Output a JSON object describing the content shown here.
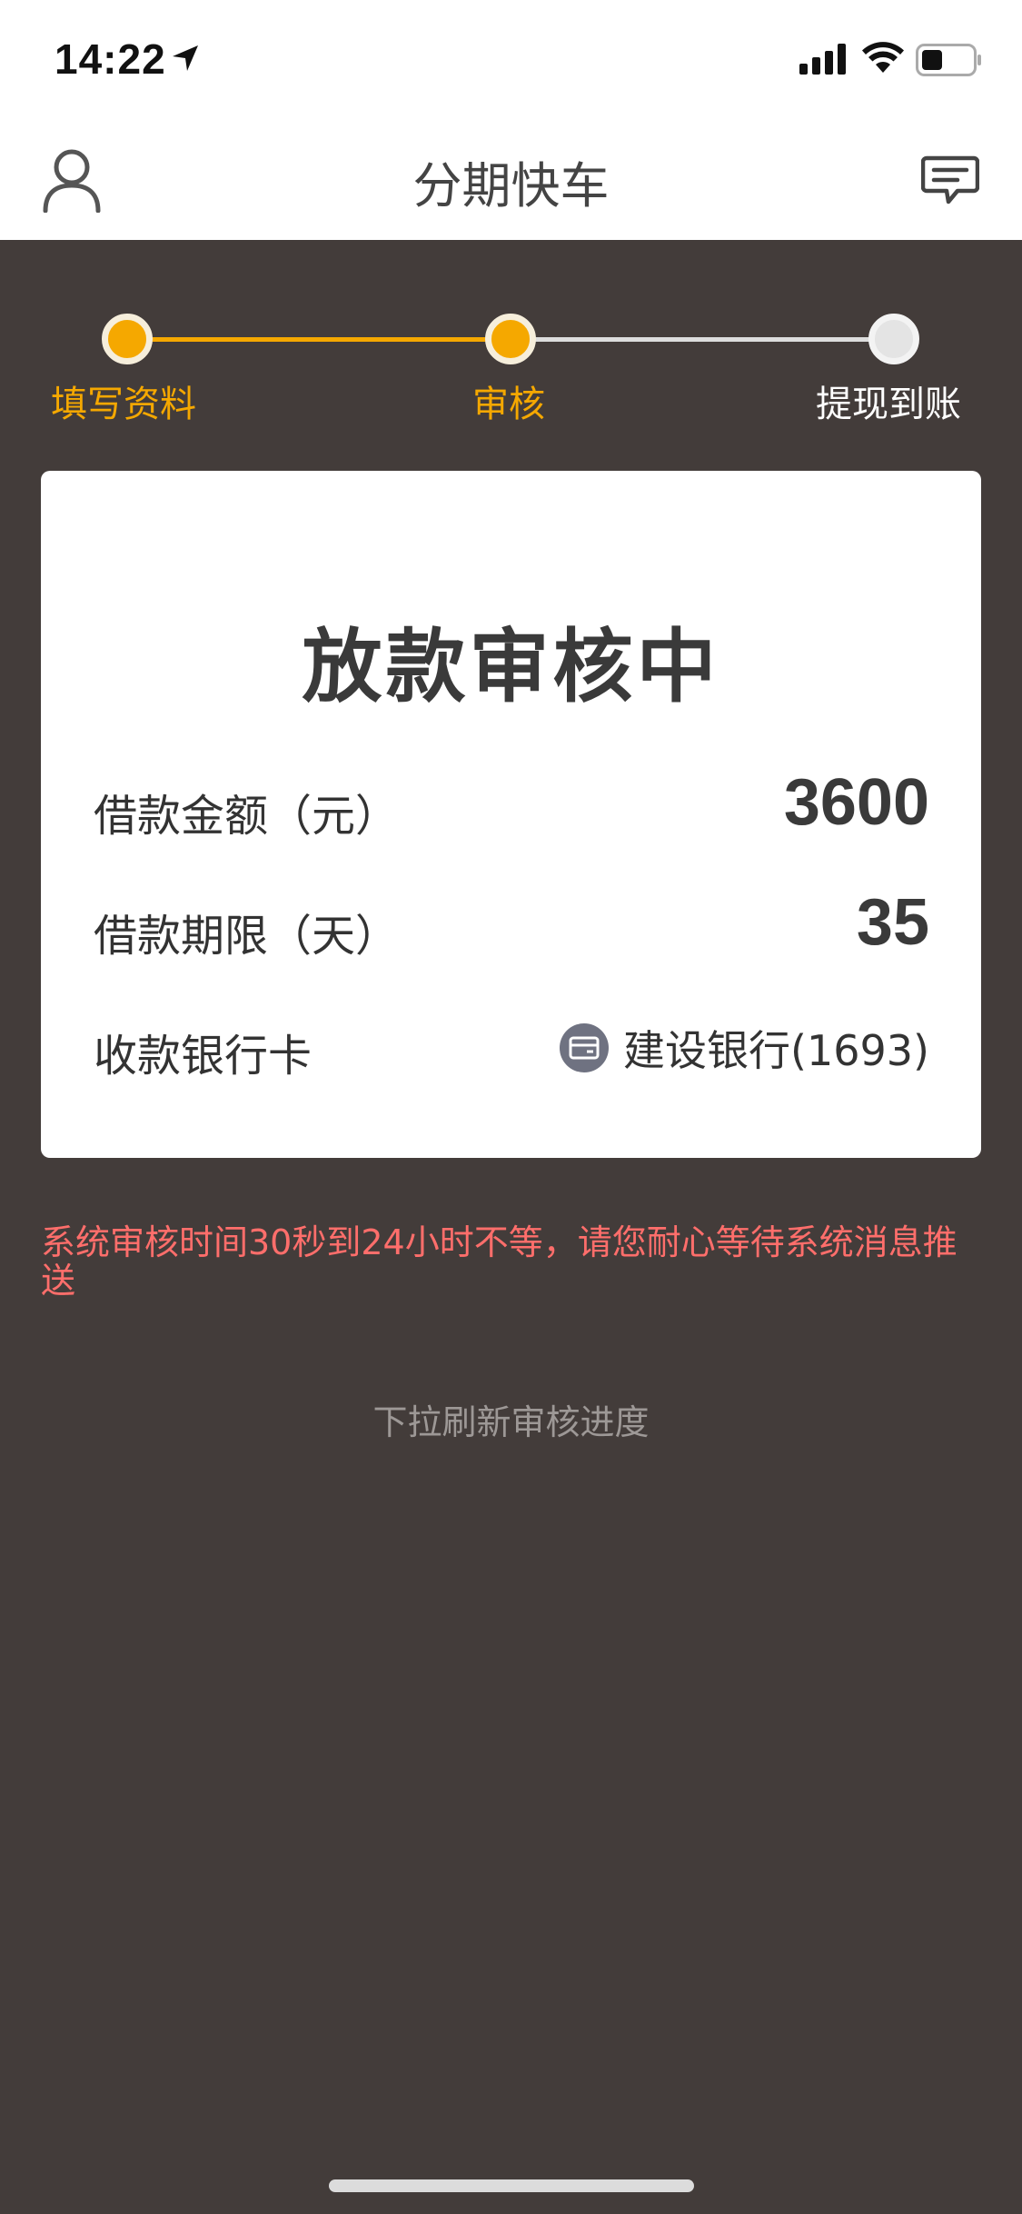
{
  "status_bar": {
    "time": "14:22"
  },
  "nav": {
    "title": "分期快车",
    "left_icon": "user-icon",
    "right_icon": "message-icon"
  },
  "steps": {
    "items": [
      {
        "label": "填写资料",
        "state": "done"
      },
      {
        "label": "审核",
        "state": "active"
      },
      {
        "label": "提现到账",
        "state": "pending"
      }
    ],
    "colors": {
      "active": "#f5a800",
      "pending": "#e4e4e4"
    }
  },
  "card": {
    "title": "放款审核中",
    "amount_label": "借款金额（元）",
    "amount_value": "3600",
    "term_label": "借款期限（天）",
    "term_value": "35",
    "bank_label": "收款银行卡",
    "bank_value": "建设银行(1693)",
    "bank_icon": "bank-card-icon"
  },
  "notice": "系统审核时间30秒到24小时不等，请您耐心等待系统消息推送",
  "refresh_hint": "下拉刷新审核进度",
  "colors": {
    "background": "#433c3a",
    "accent": "#f5a800",
    "notice": "#ff6e6b"
  }
}
